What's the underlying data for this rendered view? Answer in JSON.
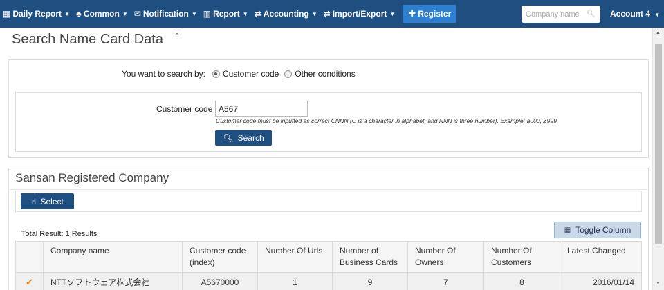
{
  "nav": {
    "items": [
      {
        "icon": "calendar-icon",
        "glyph": "▦",
        "label": "Daily Report"
      },
      {
        "icon": "users-icon",
        "glyph": "♣",
        "label": "Common"
      },
      {
        "icon": "envelope-icon",
        "glyph": "✉",
        "label": "Notification"
      },
      {
        "icon": "bar-chart-icon",
        "glyph": "▥",
        "label": "Report"
      },
      {
        "icon": "exchange-icon",
        "glyph": "⇄",
        "label": "Accounting"
      },
      {
        "icon": "import-export-icon",
        "glyph": "⇄",
        "label": "Import/Export"
      }
    ],
    "register_label": "Register",
    "company_search_placeholder": "Company name",
    "account_label": "Account 4"
  },
  "page": {
    "title": "Search Name Card Data"
  },
  "search": {
    "search_by_label": "You want to search by:",
    "option_customer_code": "Customer code",
    "option_other": "Other conditions",
    "selected_option": "Customer code",
    "customer_code_label": "Customer code",
    "customer_code_value": "A567",
    "hint": "Customer code must be inputted as correct CNNN (C is a character in alphabet, and NNN is three number). Example: a000, Z999",
    "search_button": "Search"
  },
  "results": {
    "panel_title": "Sansan Registered Company",
    "select_button": "Select",
    "total_result": "Total Result: 1 Results",
    "toggle_column_button": "Toggle Column",
    "columns": [
      "Company name",
      "Customer code (index)",
      "Number Of Urls",
      "Number of Business Cards",
      "Number Of Owners",
      "Number Of Customers",
      "Latest Changed"
    ],
    "rows": [
      {
        "checked": true,
        "company_name": "NTTソフトウェア株式会社",
        "customer_code": "A5670000",
        "urls": "1",
        "business_cards": "9",
        "owners": "7",
        "customers": "8",
        "latest_changed": "2016/01/14"
      }
    ]
  },
  "colors": {
    "nav_bg": "#1f4e80",
    "register_bg": "#2f7fd0",
    "primary_button": "#1f4e80",
    "toggle_button_bg": "#c9d9e9",
    "check_color": "#e6801a"
  }
}
